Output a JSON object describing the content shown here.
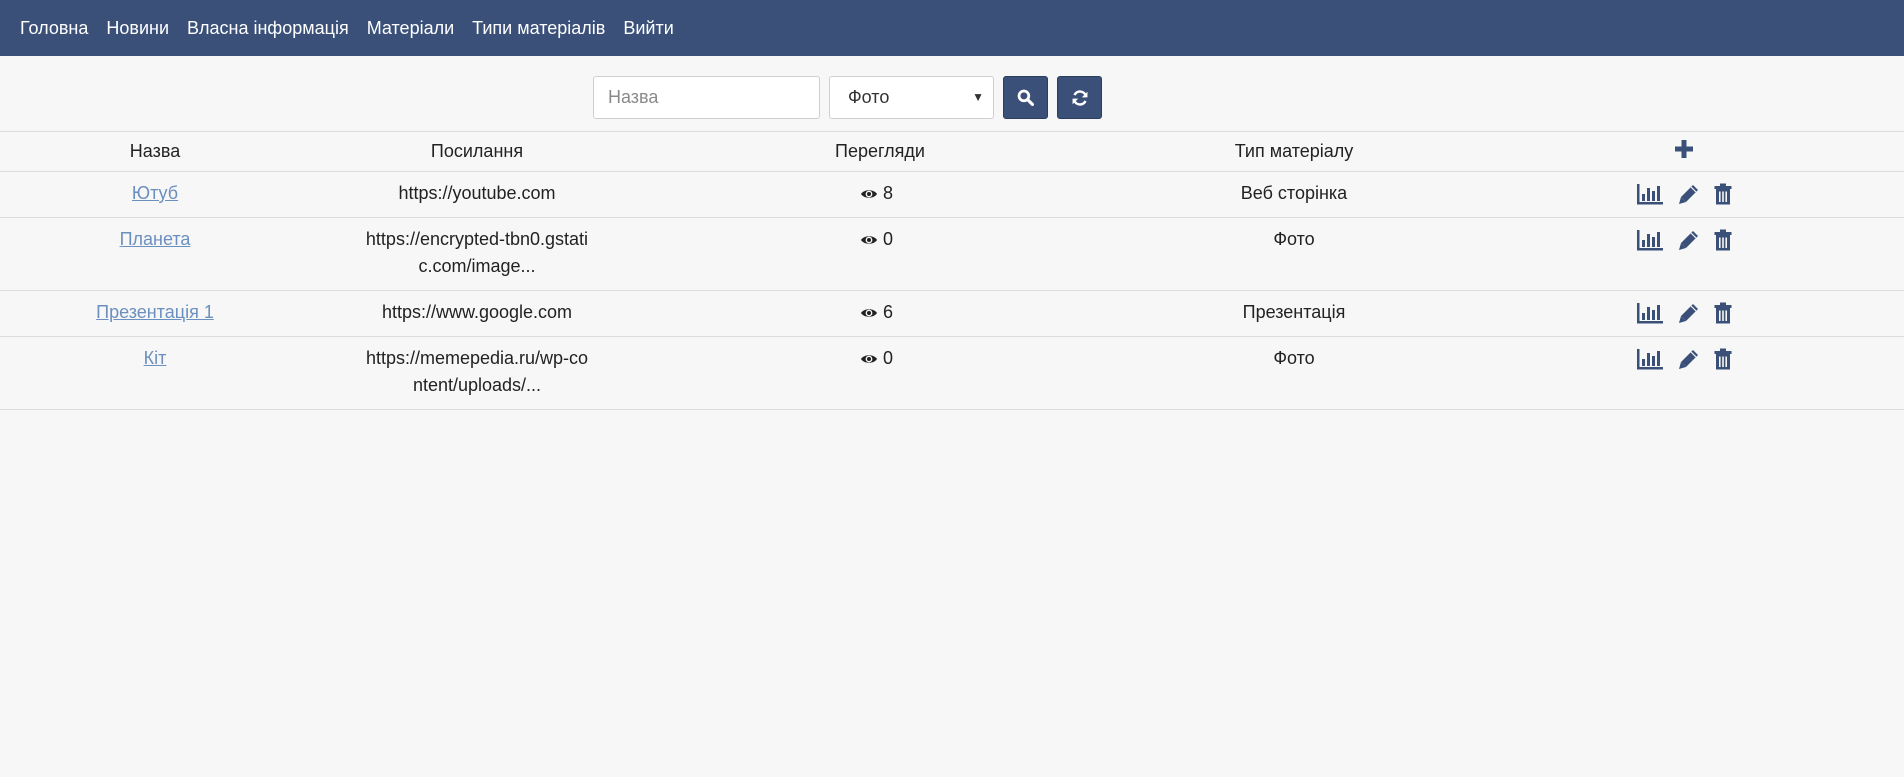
{
  "nav": {
    "items": [
      {
        "label": "Головна"
      },
      {
        "label": "Новини"
      },
      {
        "label": "Власна інформація"
      },
      {
        "label": "Матеріали"
      },
      {
        "label": "Типи матеріалів"
      },
      {
        "label": "Вийти"
      }
    ]
  },
  "filters": {
    "name_placeholder": "Назва",
    "name_value": "",
    "type_selected": "Фото",
    "search_icon": "search-icon",
    "refresh_icon": "refresh-icon"
  },
  "table": {
    "headers": {
      "name": "Назва",
      "link": "Посилання",
      "views": "Перегляди",
      "type": "Тип матеріалу",
      "add_icon": "plus-icon"
    },
    "rows": [
      {
        "name": "Ютуб",
        "link": "https://youtube.com",
        "views": "8",
        "type": "Веб сторінка"
      },
      {
        "name": "Планета",
        "link": "https://encrypted-tbn0.gstatic.com/image...",
        "views": "0",
        "type": "Фото"
      },
      {
        "name": "Презентація 1",
        "link": "https://www.google.com",
        "views": "6",
        "type": "Презентація"
      },
      {
        "name": "Кіт",
        "link": "https://memepedia.ru/wp-content/uploads/...",
        "views": "0",
        "type": "Фото"
      }
    ],
    "row_action_icons": [
      "bar-chart-icon",
      "pencil-icon",
      "trash-icon"
    ]
  },
  "colors": {
    "navbar": "#3a5079",
    "accent": "#3a5079",
    "link": "#6b8fbf",
    "background": "#f7f7f7"
  }
}
